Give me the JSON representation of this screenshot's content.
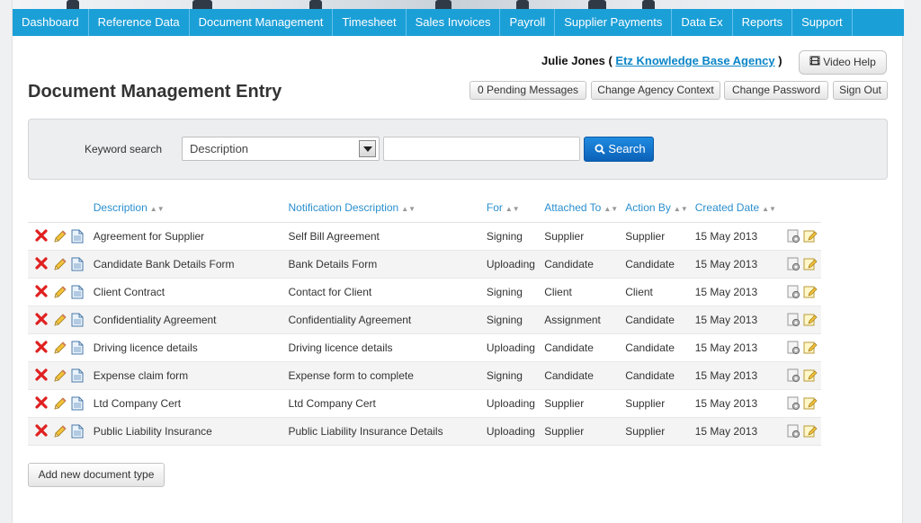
{
  "nav": {
    "items": [
      {
        "label": "Dashboard"
      },
      {
        "label": "Reference Data"
      },
      {
        "label": "Document Management"
      },
      {
        "label": "Timesheet"
      },
      {
        "label": "Sales Invoices"
      },
      {
        "label": "Payroll"
      },
      {
        "label": "Supplier Payments"
      },
      {
        "label": "Data Ex"
      },
      {
        "label": "Reports"
      },
      {
        "label": "Support"
      }
    ]
  },
  "user": {
    "name": "Julie Jones",
    "paren_open": "(",
    "agency": "Etz Knowledge Base Agency",
    "paren_close": ")"
  },
  "header_buttons": {
    "video_help": "Video Help",
    "pending_messages": "0 Pending Messages",
    "change_agency_context": "Change Agency Context",
    "change_password": "Change Password",
    "sign_out": "Sign Out"
  },
  "page_title": "Document Management Entry",
  "search": {
    "label": "Keyword search",
    "field_selected": "Description",
    "keyword_value": "",
    "button": "Search"
  },
  "table": {
    "headers": [
      "Description",
      "Notification Description",
      "For",
      "Attached To",
      "Action By",
      "Created Date"
    ],
    "rows": [
      {
        "description": "Agreement for Supplier",
        "notification": "Self Bill Agreement",
        "for": "Signing",
        "attached_to": "Supplier",
        "action_by": "Supplier",
        "created": "15 May 2013"
      },
      {
        "description": "Candidate Bank Details Form",
        "notification": "Bank Details Form",
        "for": "Uploading",
        "attached_to": "Candidate",
        "action_by": "Candidate",
        "created": "15 May 2013"
      },
      {
        "description": "Client Contract",
        "notification": "Contact for Client",
        "for": "Signing",
        "attached_to": "Client",
        "action_by": "Client",
        "created": "15 May 2013"
      },
      {
        "description": "Confidentiality Agreement",
        "notification": "Confidentiality Agreement",
        "for": "Signing",
        "attached_to": "Assignment",
        "action_by": "Candidate",
        "created": "15 May 2013"
      },
      {
        "description": "Driving licence details",
        "notification": "Driving licence details",
        "for": "Uploading",
        "attached_to": "Candidate",
        "action_by": "Candidate",
        "created": "15 May 2013"
      },
      {
        "description": "Expense claim form",
        "notification": "Expense form to complete",
        "for": "Signing",
        "attached_to": "Candidate",
        "action_by": "Candidate",
        "created": "15 May 2013"
      },
      {
        "description": "Ltd Company Cert",
        "notification": "Ltd Company Cert",
        "for": "Uploading",
        "attached_to": "Supplier",
        "action_by": "Supplier",
        "created": "15 May 2013"
      },
      {
        "description": "Public Liability Insurance",
        "notification": "Public Liability Insurance Details",
        "for": "Uploading",
        "attached_to": "Supplier",
        "action_by": "Supplier",
        "created": "15 May 2013"
      }
    ]
  },
  "add_button": "Add new document type",
  "colors": {
    "nav_bg": "#1b9fd7",
    "link": "#2b8fce",
    "search_button": "#0b61b8",
    "delete_icon": "#e02020"
  },
  "row_icons": [
    "delete-icon",
    "edit-pencil-icon",
    "document-icon"
  ],
  "row_action_icons": [
    "settings-gear-icon",
    "notepad-edit-icon"
  ]
}
